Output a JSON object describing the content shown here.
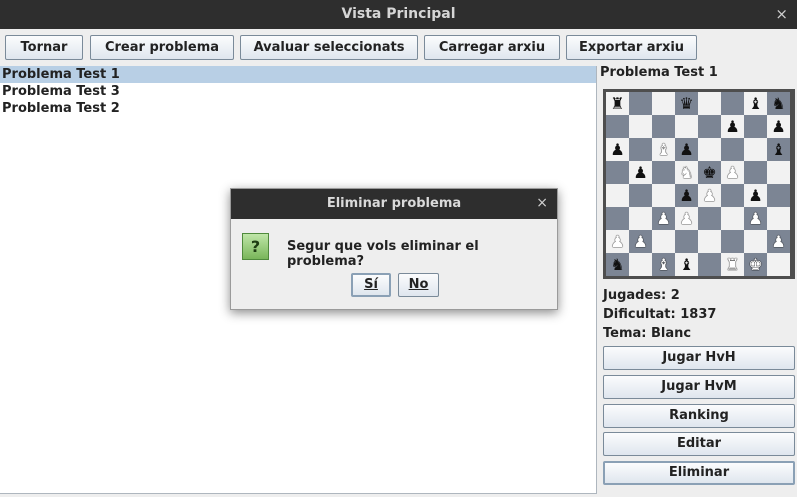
{
  "window": {
    "title": "Vista Principal",
    "close_glyph": "×"
  },
  "toolbar": {
    "buttons": [
      "Tornar",
      "Crear problema",
      "Avaluar seleccionats",
      "Carregar arxiu",
      "Exportar arxiu"
    ]
  },
  "problems": {
    "items": [
      "Problema Test 1",
      "Problema Test 3",
      "Problema Test 2"
    ],
    "selected_index": 0
  },
  "detail": {
    "title": "Problema Test 1",
    "board": [
      [
        "bR",
        "",
        "",
        "bQ",
        "",
        "",
        "bB",
        "bN"
      ],
      [
        "",
        "",
        "",
        "",
        "",
        "bP",
        "",
        "bP"
      ],
      [
        "bP",
        "",
        "wB",
        "bP",
        "",
        "",
        "",
        "bB"
      ],
      [
        "",
        "bP",
        "",
        "wN",
        "bK",
        "wP",
        "",
        ""
      ],
      [
        "",
        "",
        "",
        "bP",
        "wP",
        "",
        "bP",
        ""
      ],
      [
        "",
        "",
        "wP",
        "wP",
        "",
        "",
        "wP",
        ""
      ],
      [
        "wP",
        "wP",
        "",
        "",
        "",
        "",
        "",
        "wP"
      ],
      [
        "bN",
        "",
        "wB",
        "bB",
        "",
        "wR",
        "wK",
        ""
      ]
    ],
    "jugades": "Jugades: 2",
    "dificultat": "Dificultat: 1837",
    "tema": "Tema: Blanc",
    "buttons": [
      "Jugar HvH",
      "Jugar HvM",
      "Ranking",
      "Editar",
      "Eliminar"
    ]
  },
  "dialog": {
    "title": "Eliminar problema",
    "close_glyph": "×",
    "icon": "question-icon",
    "icon_glyph": "?",
    "message": "Segur que vols eliminar el problema?",
    "yes_label": "Sí",
    "no_label": "No"
  }
}
